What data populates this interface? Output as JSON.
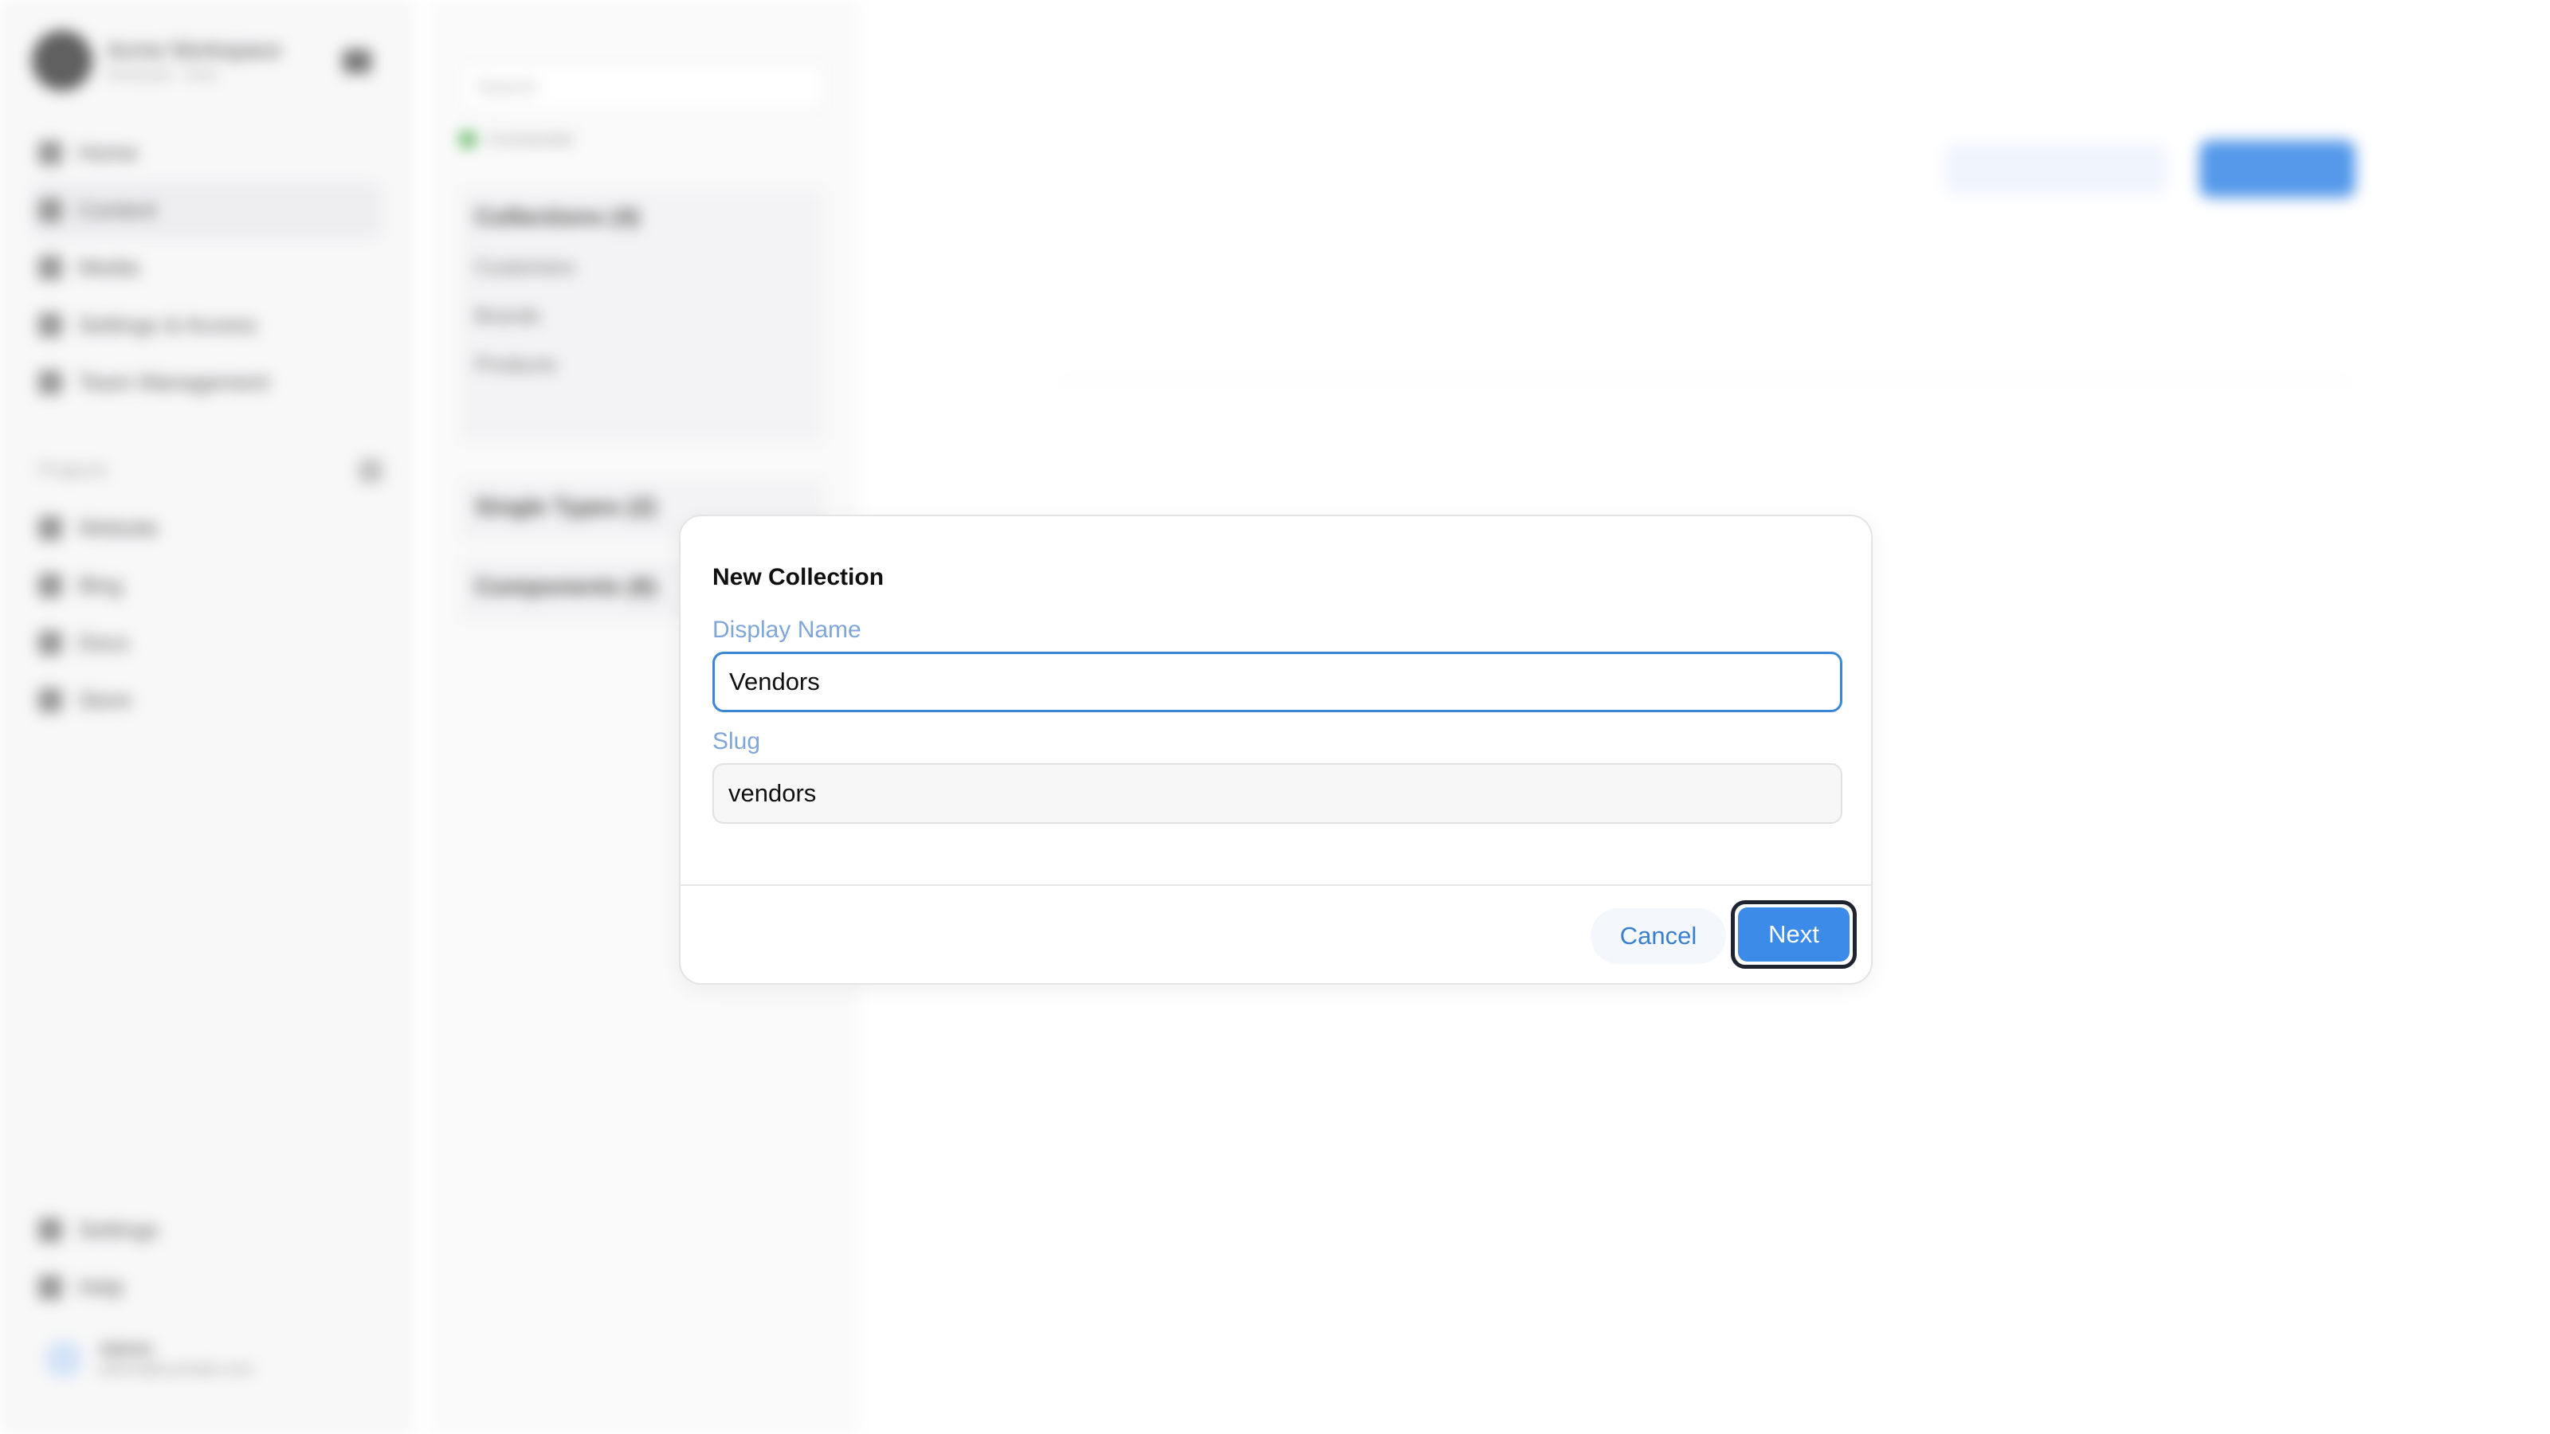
{
  "sidebar": {
    "workspace_name": "Acme Workspace",
    "workspace_sub": "Personal · Free",
    "nav": [
      {
        "label": "Home"
      },
      {
        "label": "Content"
      },
      {
        "label": "Media"
      },
      {
        "label": "Settings & Access"
      },
      {
        "label": "Team Management"
      }
    ],
    "section_label": "Projects",
    "projects": [
      {
        "label": "Website"
      },
      {
        "label": "Blog"
      },
      {
        "label": "Docs"
      },
      {
        "label": "Store"
      }
    ],
    "footer_items": [
      {
        "label": "Settings"
      },
      {
        "label": "Help"
      }
    ],
    "user_name": "Admin",
    "user_email": "admin@example.com"
  },
  "panel": {
    "search_placeholder": "Search",
    "status_text": "Connected",
    "groups": [
      {
        "title": "Collections (4)",
        "items": [
          "Customers",
          "Brands",
          "Products"
        ]
      },
      {
        "title": "Single Types (2)",
        "items": []
      },
      {
        "title": "Components (6)",
        "items": []
      }
    ]
  },
  "modal": {
    "title": "New Collection",
    "display_name_label": "Display Name",
    "display_name_value": "Vendors",
    "slug_label": "Slug",
    "slug_value": "vendors",
    "cancel_label": "Cancel",
    "next_label": "Next"
  },
  "colors": {
    "accent": "#3d8be8",
    "label": "#80a6d8",
    "focus_ring": "#1e2530"
  }
}
